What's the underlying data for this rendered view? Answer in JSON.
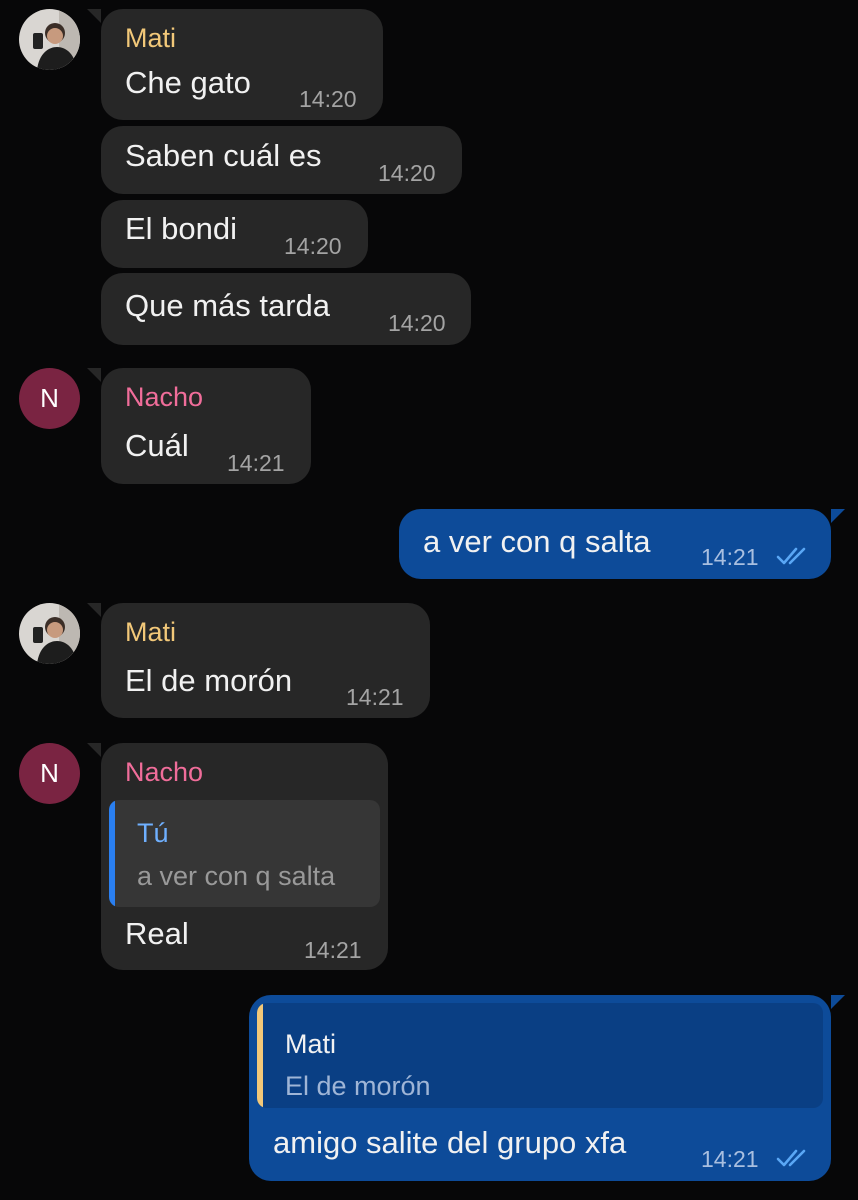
{
  "messages": {
    "m1": {
      "sender": "Mati",
      "text": "Che gato",
      "time": "14:20"
    },
    "m2": {
      "text": "Saben cuál es",
      "time": "14:20"
    },
    "m3": {
      "text": "El bondi",
      "time": "14:20"
    },
    "m4": {
      "text": "Que más tarda",
      "time": "14:20"
    },
    "m5": {
      "sender": "Nacho",
      "avatar_letter": "N",
      "text": "Cuál",
      "time": "14:21"
    },
    "m6": {
      "text": "a ver con q salta",
      "time": "14:21"
    },
    "m7": {
      "sender": "Mati",
      "text": "El de morón",
      "time": "14:21"
    },
    "m8": {
      "sender": "Nacho",
      "avatar_letter": "N",
      "quote_sender": "Tú",
      "quote_text": "a ver con q salta",
      "text": "Real",
      "time": "14:21"
    },
    "m9": {
      "quote_sender": "Mati",
      "quote_text": "El de morón",
      "text": "amigo salite del grupo xfa",
      "time": "14:21"
    }
  },
  "colors": {
    "background": "#070708",
    "incoming_bubble": "#272727",
    "outgoing_bubble": "#0d4b99",
    "mati_name": "#f2c879",
    "nacho_name": "#f06d9a",
    "nacho_avatar": "#7a2442",
    "read_ticks": "#5aa7f5"
  },
  "icons": {
    "read_receipt": "double-check-icon"
  }
}
